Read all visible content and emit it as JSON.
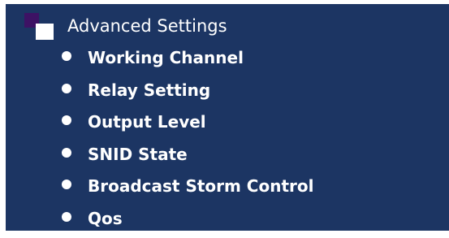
{
  "menu": {
    "header": {
      "label": "Advanced Settings",
      "icon": "folder-open-icon"
    },
    "items": [
      {
        "label": "Working Channel"
      },
      {
        "label": "Relay Setting"
      },
      {
        "label": "Output Level"
      },
      {
        "label": "SNID State"
      },
      {
        "label": "Broadcast Storm Control"
      },
      {
        "label": "Qos"
      }
    ],
    "colors": {
      "background": "#1c3563",
      "text": "#ffffff",
      "icon_back": "#3d1264",
      "icon_front": "#ffffff"
    }
  }
}
